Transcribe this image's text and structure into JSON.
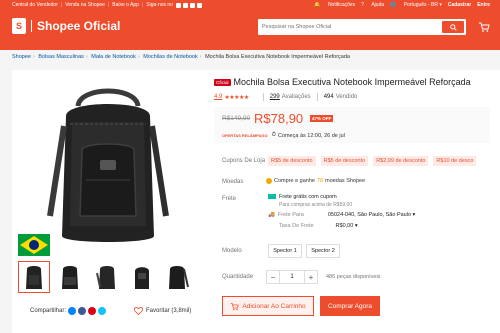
{
  "topbar": {
    "seller_center": "Central do Vendedor",
    "sell": "Venda na Shopee",
    "download": "Baixe o App",
    "follow": "Siga-nos no",
    "notifications": "Notificações",
    "help": "Ajuda",
    "language": "Português - BR",
    "register": "Cadastrar",
    "login": "Entre"
  },
  "brand": {
    "name": "Shopee Oficial",
    "logo_letter": "S"
  },
  "search": {
    "placeholder": "Pesquisar na Shopee Oficial"
  },
  "breadcrumb": [
    "Shopee",
    "Bolsas Masculinas",
    "Mala de Notebook",
    "Mochilas de Notebook",
    "Mochila Bolsa Executiva Notebook Impermeável Reforçada"
  ],
  "product": {
    "badge": "Oficial",
    "title": "Mochila Bolsa Executiva Notebook Impermeável Reforçada",
    "rating_value": "4.9",
    "stars": "★★★★★",
    "reviews_count": "299",
    "reviews_label": "Avaliações",
    "sold_count": "494",
    "sold_label": "Vendido",
    "old_price": "R$149,90",
    "price": "R$78,90",
    "discount": "47% OFF",
    "promo_tag": "OFERTAS RELÂMPAGO",
    "promo_text": "Começa às 12:00, 26 de jul"
  },
  "coupons": {
    "label": "Cupons De Loja",
    "items": [
      "R$5 de desconto",
      "R$5 de desconto",
      "R$2,99 de desconto",
      "R$10 de desco"
    ]
  },
  "coins": {
    "label": "Moedas",
    "prefix": "Compre e ganhe",
    "amount": "78",
    "suffix": "moedas Shopee"
  },
  "shipping": {
    "label": "Frete",
    "free_text": "Frete grátis com cupom",
    "free_sub": "Para compras acima de R$59,00",
    "to_label": "Frete Para",
    "to_value": "05024-040, São Paulo, São Paulo",
    "fee_label": "Taxa De Frete",
    "fee_value": "R$0,00"
  },
  "model": {
    "label": "Modelo",
    "options": [
      "Spector 1",
      "Spector 2"
    ]
  },
  "quantity": {
    "label": "Quantidade",
    "value": "1",
    "available": "486 peças disponíveis"
  },
  "actions": {
    "add_to_cart": "Adicionar Ao Carrinho",
    "buy_now": "Comprar Agora"
  },
  "share": {
    "label": "Compartilhar:"
  },
  "favorite": {
    "label": "Favoritar (3,8mil)"
  },
  "colors": {
    "accent": "#ee4d2d",
    "price_bg": "#fafafa",
    "coin": "#f6a700",
    "shipping": "#00bfa5"
  }
}
